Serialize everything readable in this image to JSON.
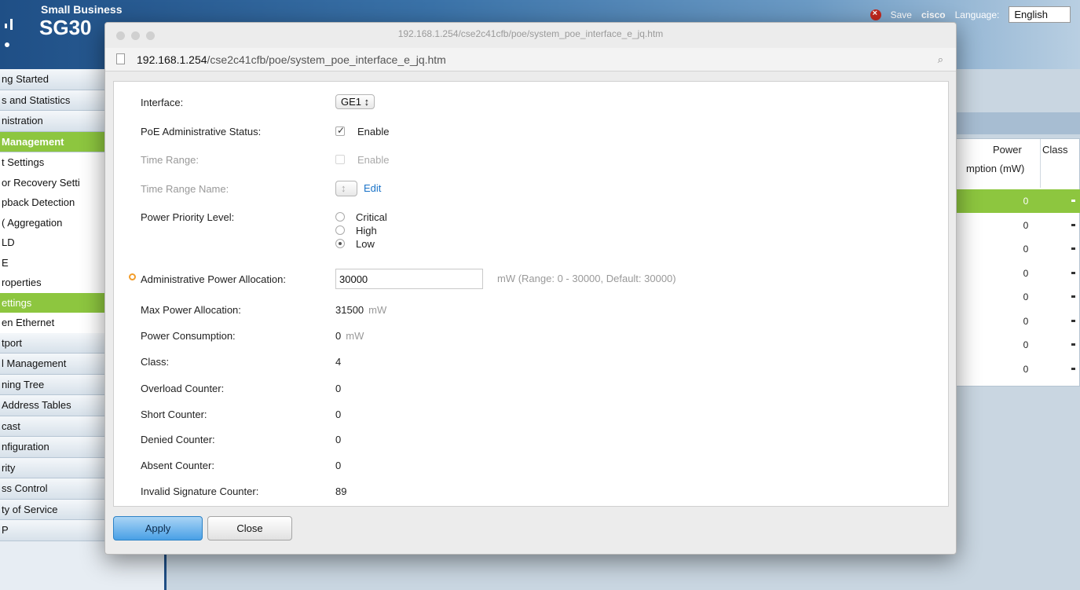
{
  "app": {
    "brand_line1": "Small Business",
    "brand_line2": "SG30",
    "save_label": "Save",
    "user": "cisco",
    "language_label": "Language:",
    "language_value": "English"
  },
  "sidebar": {
    "items": [
      {
        "label": "ng Started"
      },
      {
        "label": "s and Statistics"
      },
      {
        "label": "nistration"
      },
      {
        "label": "Management",
        "active": true
      },
      {
        "label": "t Settings",
        "sub": true
      },
      {
        "label": "or Recovery Setti",
        "sub": true
      },
      {
        "label": "pback Detection",
        "sub": true
      },
      {
        "label": "( Aggregation",
        "sub": true
      },
      {
        "label": "LD",
        "sub": true
      },
      {
        "label": "E",
        "sub": true
      },
      {
        "label": "roperties",
        "sub": true
      },
      {
        "label": "ettings",
        "sub": true,
        "current": true
      },
      {
        "label": "en Ethernet",
        "sub": true
      },
      {
        "label": "tport"
      },
      {
        "label": "l Management"
      },
      {
        "label": "ning Tree"
      },
      {
        "label": "Address Tables"
      },
      {
        "label": "cast"
      },
      {
        "label": "nfiguration"
      },
      {
        "label": "rity"
      },
      {
        "label": "ss Control"
      },
      {
        "label": "ty of Service"
      },
      {
        "label": "P"
      }
    ]
  },
  "bg_table": {
    "header_power_line1": "Power",
    "header_power_line2": "mption (mW)",
    "header_class": "Class",
    "rows": [
      "0",
      "0",
      "0",
      "0",
      "0",
      "0",
      "0",
      "0"
    ]
  },
  "popup": {
    "window_title": "192.168.1.254/cse2c41cfb/poe/system_poe_interface_e_jq.htm",
    "url_host": "192.168.1.254",
    "url_path": "/cse2c41cfb/poe/system_poe_interface_e_jq.htm",
    "form": {
      "interface_label": "Interface:",
      "interface_value": "GE1",
      "admin_status_label": "PoE Administrative Status:",
      "admin_status_option": "Enable",
      "time_range_label": "Time Range:",
      "time_range_option": "Enable",
      "time_range_name_label": "Time Range Name:",
      "edit_link": "Edit",
      "priority_label": "Power Priority Level:",
      "priority_options": [
        "Critical",
        "High",
        "Low"
      ],
      "priority_selected": "Low",
      "alloc_label": "Administrative Power Allocation:",
      "alloc_value": "30000",
      "alloc_hint": "mW (Range: 0 - 30000, Default: 30000)",
      "max_alloc_label": "Max Power Allocation:",
      "max_alloc_value": "31500",
      "consumption_label": "Power Consumption:",
      "consumption_value": "0",
      "unit_mw": "mW",
      "class_label": "Class:",
      "class_value": "4",
      "overload_label": "Overload Counter:",
      "overload_value": "0",
      "short_label": "Short Counter:",
      "short_value": "0",
      "denied_label": "Denied Counter:",
      "denied_value": "0",
      "absent_label": "Absent Counter:",
      "absent_value": "0",
      "invalid_sig_label": "Invalid Signature Counter:",
      "invalid_sig_value": "89"
    },
    "buttons": {
      "apply": "Apply",
      "close": "Close"
    }
  },
  "colors": {
    "accent_green": "#8dc63f",
    "header_blue": "#1f4f86",
    "apply_blue": "#49a0e6",
    "required_orange": "#f29d2b"
  }
}
